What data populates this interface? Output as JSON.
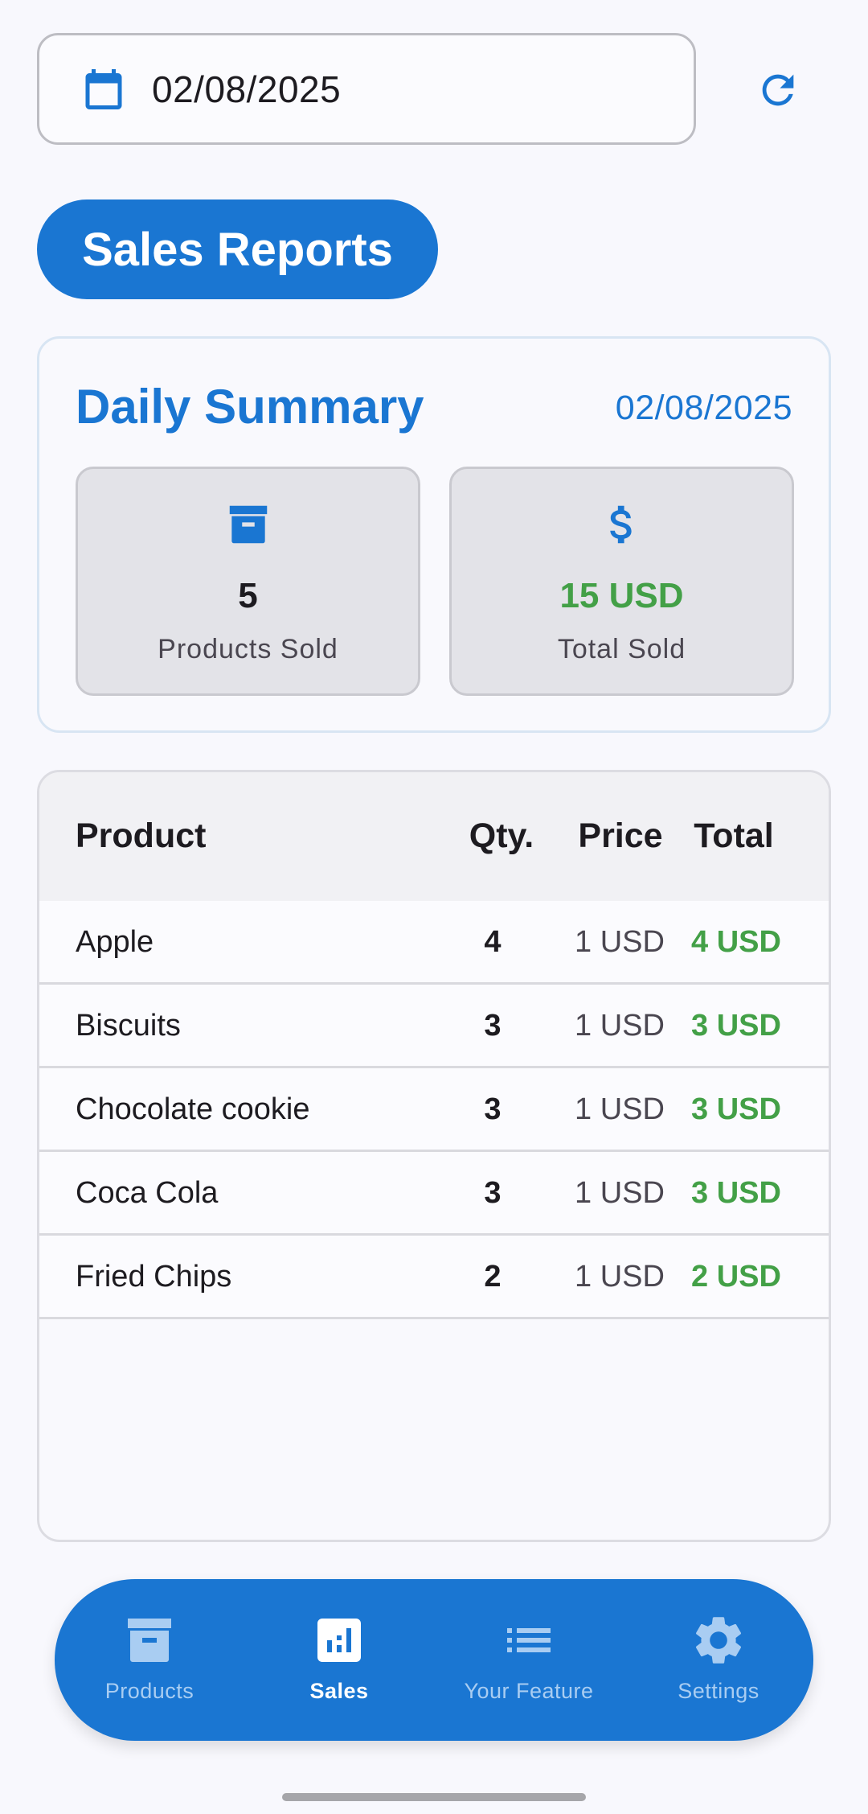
{
  "date_picker": {
    "value": "02/08/2025",
    "icon": "calendar-icon"
  },
  "refresh": {
    "icon": "refresh-icon"
  },
  "page_title": "Sales Reports",
  "summary": {
    "title": "Daily Summary",
    "date": "02/08/2025",
    "products_sold": {
      "value": "5",
      "label": "Products Sold",
      "icon": "archive-icon"
    },
    "total_sold": {
      "value": "15 USD",
      "label": "Total Sold",
      "icon": "dollar-icon"
    }
  },
  "table": {
    "headers": {
      "product": "Product",
      "qty": "Qty.",
      "price": "Price",
      "total": "Total"
    },
    "rows": [
      {
        "product": "Apple",
        "qty": "4",
        "price": "1 USD",
        "total": "4 USD"
      },
      {
        "product": "Biscuits",
        "qty": "3",
        "price": "1 USD",
        "total": "3 USD"
      },
      {
        "product": "Chocolate cookie",
        "qty": "3",
        "price": "1 USD",
        "total": "3 USD"
      },
      {
        "product": "Coca Cola",
        "qty": "3",
        "price": "1 USD",
        "total": "3 USD"
      },
      {
        "product": "Fried Chips",
        "qty": "2",
        "price": "1 USD",
        "total": "2 USD"
      }
    ]
  },
  "nav": {
    "items": [
      {
        "label": "Products",
        "icon": "archive-icon",
        "active": false
      },
      {
        "label": "Sales",
        "icon": "bar-chart-icon",
        "active": true
      },
      {
        "label": "Your Feature",
        "icon": "list-icon",
        "active": false
      },
      {
        "label": "Settings",
        "icon": "gear-icon",
        "active": false
      }
    ]
  },
  "colors": {
    "primary": "#1a76d2",
    "positive": "#43a047",
    "background": "#f8f8fd"
  }
}
